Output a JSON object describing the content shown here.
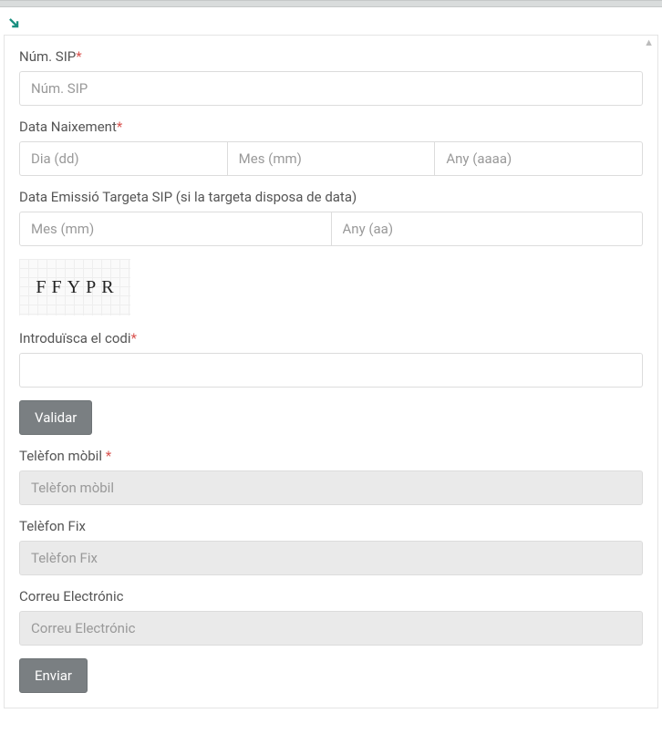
{
  "fields": {
    "num_sip": {
      "label": "Núm. SIP",
      "required": "*",
      "placeholder": "Núm. SIP"
    },
    "birth_date": {
      "label": "Data Naixement",
      "required": "*",
      "day_placeholder": "Dia (dd)",
      "month_placeholder": "Mes (mm)",
      "year_placeholder": "Any (aaaa)"
    },
    "issue_date": {
      "label": "Data Emissió Targeta SIP (si la targeta disposa de data)",
      "month_placeholder": "Mes (mm)",
      "year_placeholder": "Any (aa)"
    },
    "captcha": {
      "text": "FFYPR",
      "label": "Introduïsca el codi",
      "required": "*"
    },
    "mobile": {
      "label": "Telèfon mòbil ",
      "required": "*",
      "placeholder": "Telèfon mòbil"
    },
    "landline": {
      "label": "Telèfon Fix",
      "placeholder": "Telèfon Fix"
    },
    "email": {
      "label": "Correu Electrónic",
      "placeholder": "Correu Electrónic"
    }
  },
  "buttons": {
    "validate": "Validar",
    "submit": "Enviar"
  }
}
